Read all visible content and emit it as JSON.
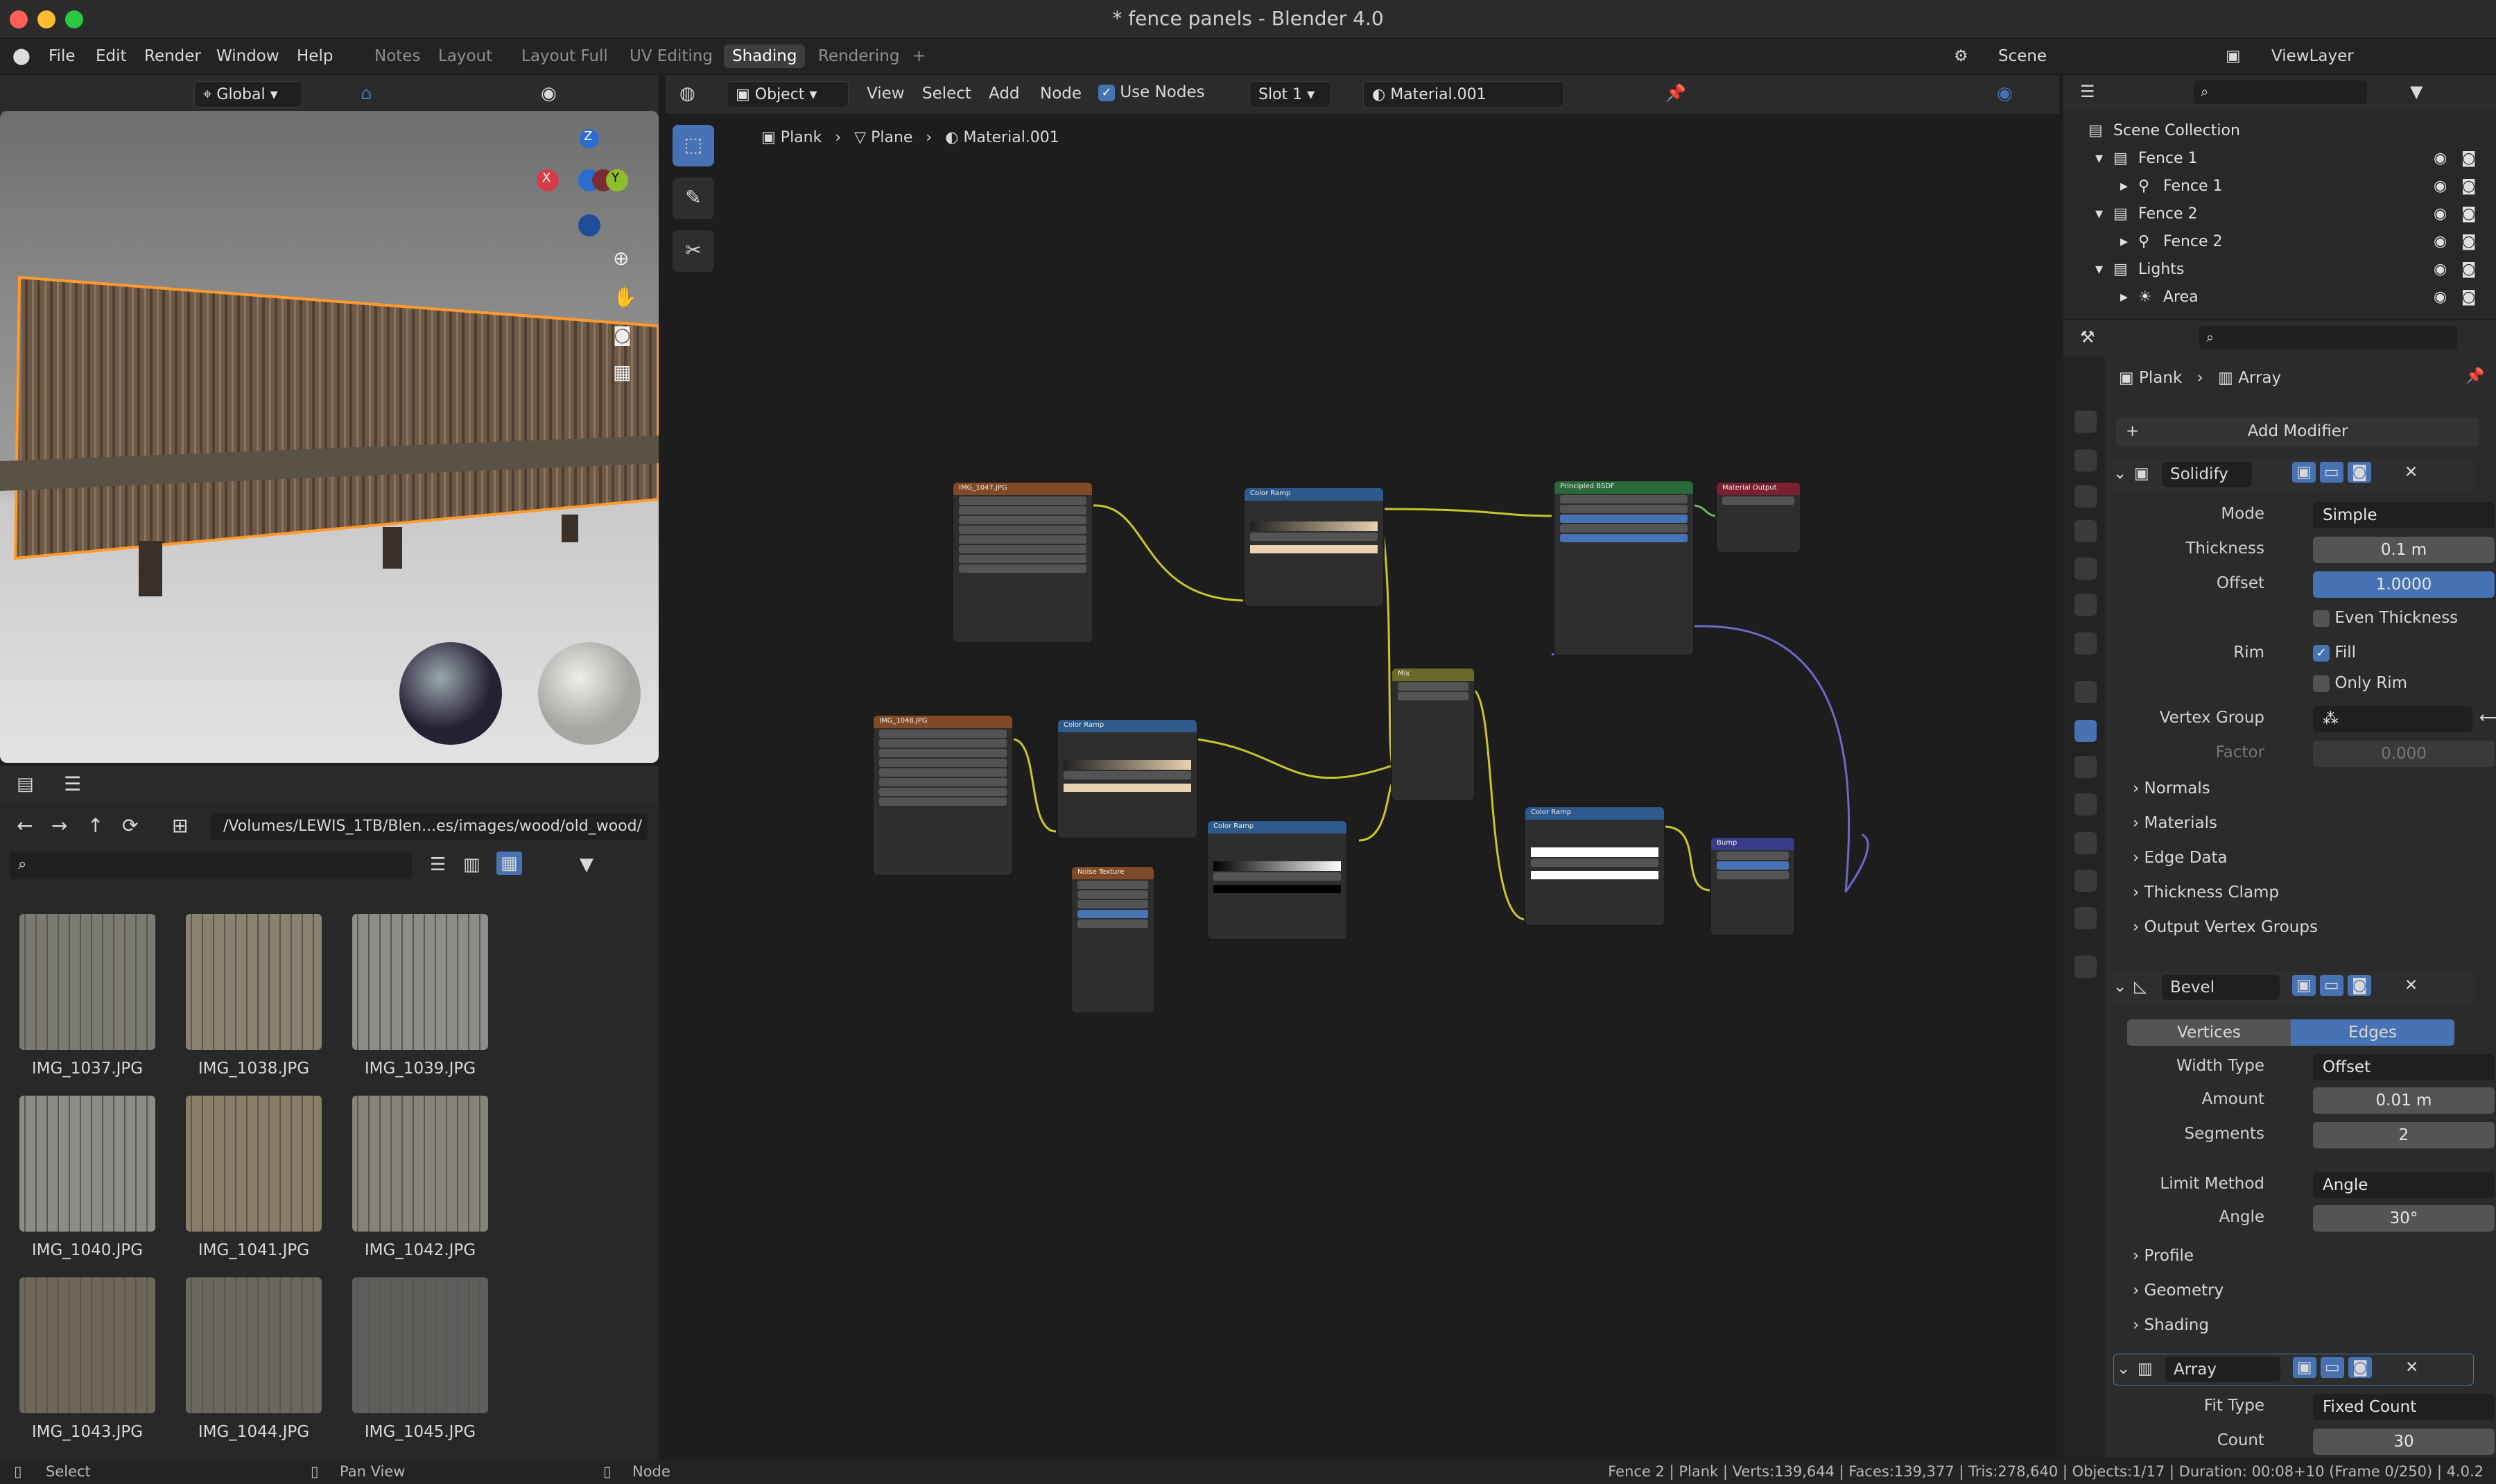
{
  "window": {
    "title": "* fence panels - Blender 4.0"
  },
  "menu": {
    "items": [
      "File",
      "Edit",
      "Render",
      "Window",
      "Help"
    ],
    "workspaces": [
      "Notes",
      "Layout",
      "Layout Full",
      "UV Editing",
      "Shading",
      "Rendering"
    ],
    "active_workspace": "Shading",
    "scene": "Scene",
    "view_layer": "ViewLayer"
  },
  "viewport": {
    "orientation": "Global",
    "gizmo": {
      "x": "X",
      "y": "Y",
      "z": "Z"
    }
  },
  "file_browser": {
    "path": "/Volumes/LEWIS_1TB/Blen...es/images/wood/old_wood/",
    "search_placeholder": "",
    "files": [
      "IMG_1037.JPG",
      "IMG_1038.JPG",
      "IMG_1039.JPG",
      "IMG_1040.JPG",
      "IMG_1041.JPG",
      "IMG_1042.JPG",
      "IMG_1043.JPG",
      "IMG_1044.JPG",
      "IMG_1045.JPG"
    ]
  },
  "node_editor": {
    "mode": "Object",
    "menu": [
      "View",
      "Select",
      "Add",
      "Node"
    ],
    "use_nodes_label": "Use Nodes",
    "slot": "Slot 1",
    "material": "Material.001",
    "breadcrumb": [
      "Plank",
      "Plane",
      "Material.001"
    ],
    "nodes": {
      "img1": "IMG_1047.JPG",
      "img2": "IMG_1048.JPG",
      "cr1": "Color Ramp",
      "cr2": "Color Ramp",
      "cr3": "Color Ramp",
      "cr4": "Color Ramp",
      "bsdf": "Principled BSDF",
      "output": "Material Output",
      "mix": "Mix",
      "noise": "Noise Texture",
      "bump": "Bump"
    }
  },
  "outliner": {
    "rows": [
      {
        "label": "Scene Collection"
      },
      {
        "label": "Fence 1"
      },
      {
        "label": "Fence 1"
      },
      {
        "label": "Fence 2"
      },
      {
        "label": "Fence 2"
      },
      {
        "label": "Lights"
      },
      {
        "label": "Area"
      }
    ]
  },
  "properties": {
    "breadcrumb": [
      "Plank",
      "Array"
    ],
    "add_modifier": "Add Modifier",
    "solidify": {
      "name": "Solidify",
      "mode_label": "Mode",
      "mode": "Simple",
      "thickness_label": "Thickness",
      "thickness": "0.1 m",
      "offset_label": "Offset",
      "offset": "1.0000",
      "even_thickness": "Even Thickness",
      "rim_label": "Rim",
      "fill": "Fill",
      "only_rim": "Only Rim",
      "vertex_group_label": "Vertex Group",
      "factor_label": "Factor",
      "factor": "0.000",
      "subpanels": [
        "Normals",
        "Materials",
        "Edge Data",
        "Thickness Clamp",
        "Output Vertex Groups"
      ]
    },
    "bevel": {
      "name": "Bevel",
      "tab_vertices": "Vertices",
      "tab_edges": "Edges",
      "width_type_label": "Width Type",
      "width_type": "Offset",
      "amount_label": "Amount",
      "amount": "0.01 m",
      "segments_label": "Segments",
      "segments": "2",
      "limit_method_label": "Limit Method",
      "limit_method": "Angle",
      "angle_label": "Angle",
      "angle": "30°",
      "subpanels": [
        "Profile",
        "Geometry",
        "Shading"
      ]
    },
    "array": {
      "name": "Array",
      "fit_type_label": "Fit Type",
      "fit_type": "Fixed Count",
      "count_label": "Count",
      "count": "30"
    }
  },
  "status": {
    "select": "Select",
    "pan": "Pan View",
    "node": "Node",
    "stats": "Fence 2 | Plank | Verts:139,644 | Faces:139,377 | Tris:278,640 | Objects:1/17 | Duration: 00:08+10 (Frame 0/250) | 4.0.2"
  }
}
